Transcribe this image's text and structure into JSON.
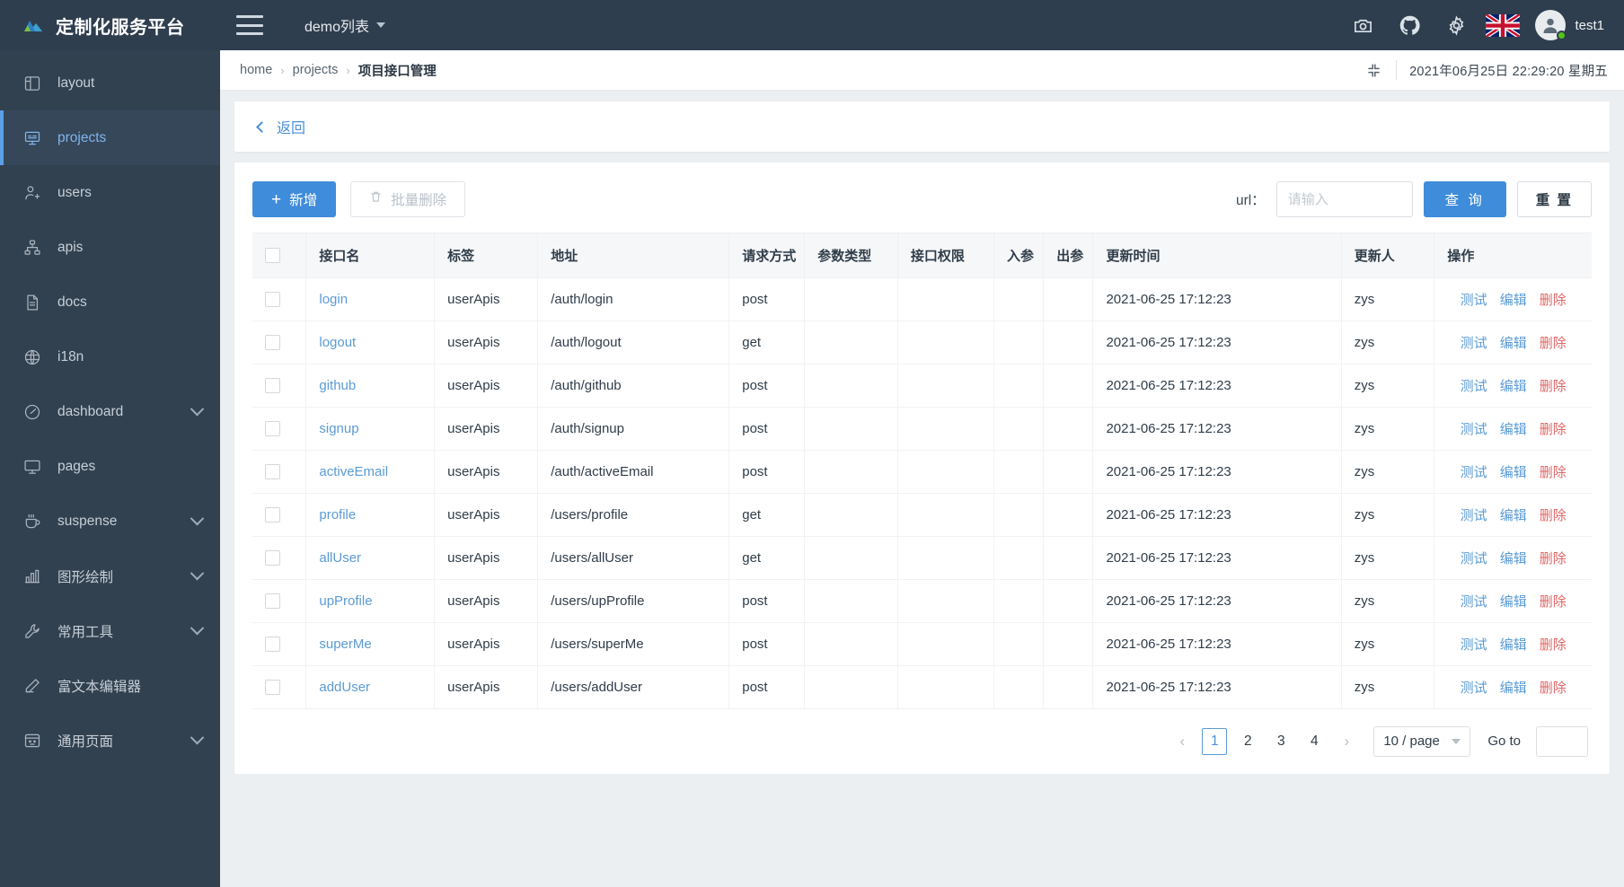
{
  "header": {
    "brand_title": "定制化服务平台",
    "logo_icon": "mountain-logo-icon",
    "menu_toggle_icon": "hamburger-icon",
    "tab_select_label": "demo列表",
    "tab_select_icon": "chevron-down-icon",
    "icons": [
      {
        "name": "camera-icon",
        "label": "camera"
      },
      {
        "name": "github-icon",
        "label": "github"
      },
      {
        "name": "gear-icon",
        "label": "settings"
      },
      {
        "name": "uk-flag-icon",
        "label": "language"
      }
    ],
    "user_name": "test1",
    "avatar_icon": "user-avatar-icon",
    "status_color": "#52c41a",
    "bg_color": "#2f3e4e"
  },
  "sidebar": {
    "bg_color": "#32414f",
    "active_color": "#7fb4ea",
    "items": [
      {
        "label": "layout",
        "icon": "layout-panel-icon",
        "expandable": false,
        "active": false
      },
      {
        "label": "projects",
        "icon": "monitor-code-icon",
        "expandable": false,
        "active": true
      },
      {
        "label": "users",
        "icon": "user-add-icon",
        "expandable": false,
        "active": false
      },
      {
        "label": "apis",
        "icon": "sitemap-icon",
        "expandable": false,
        "active": false
      },
      {
        "label": "docs",
        "icon": "file-doc-icon",
        "expandable": false,
        "active": false
      },
      {
        "label": "i18n",
        "icon": "globe-icon",
        "expandable": false,
        "active": false
      },
      {
        "label": "dashboard",
        "icon": "dashboard-icon",
        "expandable": true,
        "active": false
      },
      {
        "label": "pages",
        "icon": "desktop-icon",
        "expandable": false,
        "active": false
      },
      {
        "label": "suspense",
        "icon": "coffee-icon",
        "expandable": true,
        "active": false
      },
      {
        "label": "图形绘制",
        "icon": "bar-chart-icon",
        "expandable": true,
        "active": false
      },
      {
        "label": "常用工具",
        "icon": "wrench-icon",
        "expandable": true,
        "active": false
      },
      {
        "label": "富文本编辑器",
        "icon": "pencil-icon",
        "expandable": false,
        "active": false
      },
      {
        "label": "通用页面",
        "icon": "window-face-icon",
        "expandable": true,
        "active": false
      }
    ]
  },
  "breadcrumb": {
    "items": [
      "home",
      "projects",
      "项目接口管理"
    ],
    "separator": "›",
    "fullscreen_icon": "fullscreen-exit-icon",
    "clock": "2021年06月25日 22:29:20 星期五"
  },
  "back_bar": {
    "label": "返回",
    "icon": "chevron-left-icon"
  },
  "toolbar": {
    "add_label": "新增",
    "add_icon": "plus-icon",
    "batch_delete_label": "批量删除",
    "batch_delete_icon": "trash-icon",
    "batch_delete_disabled": true,
    "filter_label": "url：",
    "filter_value": "",
    "filter_placeholder": "请输入",
    "search_label": "查 询",
    "reset_label": "重 置",
    "primary_color": "#3f8cdb"
  },
  "table": {
    "select_all_checked": false,
    "columns": [
      "接口名",
      "标签",
      "地址",
      "请求方式",
      "参数类型",
      "接口权限",
      "入参",
      "出参",
      "更新时间",
      "更新人",
      "操作"
    ],
    "ops": [
      {
        "label": "测试",
        "kind": "blue"
      },
      {
        "label": "编辑",
        "kind": "blue"
      },
      {
        "label": "删除",
        "kind": "red"
      }
    ],
    "rows": [
      {
        "name": "login",
        "tag": "userApis",
        "addr": "/auth/login",
        "method": "post",
        "ptype": "",
        "auth": "",
        "in": "",
        "out": "",
        "time": "2021-06-25 17:12:23",
        "user": "zys"
      },
      {
        "name": "logout",
        "tag": "userApis",
        "addr": "/auth/logout",
        "method": "get",
        "ptype": "",
        "auth": "",
        "in": "",
        "out": "",
        "time": "2021-06-25 17:12:23",
        "user": "zys"
      },
      {
        "name": "github",
        "tag": "userApis",
        "addr": "/auth/github",
        "method": "post",
        "ptype": "",
        "auth": "",
        "in": "",
        "out": "",
        "time": "2021-06-25 17:12:23",
        "user": "zys"
      },
      {
        "name": "signup",
        "tag": "userApis",
        "addr": "/auth/signup",
        "method": "post",
        "ptype": "",
        "auth": "",
        "in": "",
        "out": "",
        "time": "2021-06-25 17:12:23",
        "user": "zys"
      },
      {
        "name": "activeEmail",
        "tag": "userApis",
        "addr": "/auth/activeEmail",
        "method": "post",
        "ptype": "",
        "auth": "",
        "in": "",
        "out": "",
        "time": "2021-06-25 17:12:23",
        "user": "zys"
      },
      {
        "name": "profile",
        "tag": "userApis",
        "addr": "/users/profile",
        "method": "get",
        "ptype": "",
        "auth": "",
        "in": "",
        "out": "",
        "time": "2021-06-25 17:12:23",
        "user": "zys"
      },
      {
        "name": "allUser",
        "tag": "userApis",
        "addr": "/users/allUser",
        "method": "get",
        "ptype": "",
        "auth": "",
        "in": "",
        "out": "",
        "time": "2021-06-25 17:12:23",
        "user": "zys"
      },
      {
        "name": "upProfile",
        "tag": "userApis",
        "addr": "/users/upProfile",
        "method": "post",
        "ptype": "",
        "auth": "",
        "in": "",
        "out": "",
        "time": "2021-06-25 17:12:23",
        "user": "zys"
      },
      {
        "name": "superMe",
        "tag": "userApis",
        "addr": "/users/superMe",
        "method": "post",
        "ptype": "",
        "auth": "",
        "in": "",
        "out": "",
        "time": "2021-06-25 17:12:23",
        "user": "zys"
      },
      {
        "name": "addUser",
        "tag": "userApis",
        "addr": "/users/addUser",
        "method": "post",
        "ptype": "",
        "auth": "",
        "in": "",
        "out": "",
        "time": "2021-06-25 17:12:23",
        "user": "zys"
      }
    ]
  },
  "pagination": {
    "prev_icon": "chevron-left-icon",
    "next_icon": "chevron-right-icon",
    "pages": [
      "1",
      "2",
      "3",
      "4"
    ],
    "current_page": "1",
    "page_size_label": "10 / page",
    "page_size_icon": "chevron-down-icon",
    "goto_label": "Go to",
    "goto_value": ""
  }
}
